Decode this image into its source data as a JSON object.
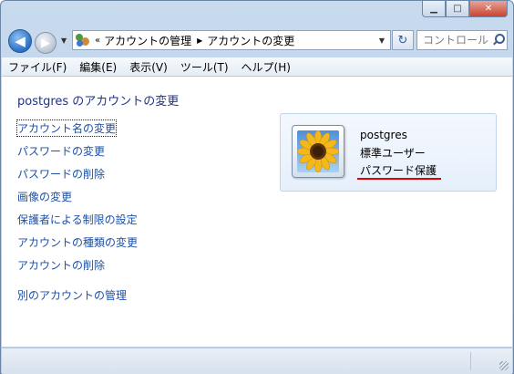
{
  "window": {
    "caption": {
      "minimize_glyph": "▁",
      "maximize_glyph": "□",
      "close_glyph": "✕"
    }
  },
  "navbar": {
    "back_glyph": "◀",
    "forward_glyph": "▶",
    "history_glyph": "▼",
    "breadcrumb_overflow": "«",
    "breadcrumb": [
      "アカウントの管理",
      "アカウントの変更"
    ],
    "breadcrumb_separator": "▶",
    "dropdown_glyph": "▼",
    "refresh_glyph": "↻",
    "search_placeholder": "コントロール ..."
  },
  "menu": {
    "items": [
      "ファイル(F)",
      "編集(E)",
      "表示(V)",
      "ツール(T)",
      "ヘルプ(H)"
    ]
  },
  "page": {
    "title": "postgres のアカウントの変更"
  },
  "tasks": [
    "アカウント名の変更",
    "パスワードの変更",
    "パスワードの削除",
    "画像の変更",
    "保護者による制限の設定",
    "アカウントの種類の変更",
    "アカウントの削除",
    "別のアカウントの管理"
  ],
  "account": {
    "name": "postgres",
    "type": "標準ユーザー",
    "password_status": "パスワード保護",
    "picture": "sunflower-picture",
    "highlight_color": "#e00000"
  },
  "colors": {
    "link": "#1e50a2",
    "title": "#1e3287",
    "chrome": "#c7daee"
  }
}
